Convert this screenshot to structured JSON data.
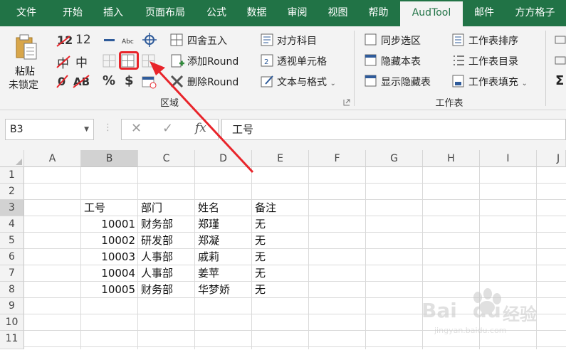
{
  "ribbon_tabs": [
    "文件",
    "开始",
    "插入",
    "页面布局",
    "公式",
    "数据",
    "审阅",
    "视图",
    "帮助",
    "AudTool",
    "邮件",
    "方方格子"
  ],
  "active_tab": "AudTool",
  "colors": {
    "brand": "#217346",
    "highlight": "#e8242a"
  },
  "ribbon": {
    "unlock_label_1": "粘贴",
    "unlock_label_2": "未锁定",
    "num12": "12",
    "zhong": "中",
    "percent": "%",
    "dollar": "$",
    "round_round": "四舍五入",
    "add_round": "添加Round",
    "del_round": "删除Round",
    "dui_fang": "对方科目",
    "pivot_cell": "透视单元格",
    "text_format": "文本与格式",
    "sync_select": "同步选区",
    "hide_sheet": "隐藏本表",
    "show_hidden": "显示隐藏表",
    "sheet_sort": "工作表排序",
    "sheet_toc": "工作表目录",
    "sheet_fill": "工作表填充",
    "group_quyu": "区域",
    "group_sheet": "工作表"
  },
  "name_box": "B3",
  "formula_value": "工号",
  "columns": [
    "A",
    "B",
    "C",
    "D",
    "E",
    "F",
    "G",
    "H",
    "I",
    "J"
  ],
  "rows": [
    "1",
    "2",
    "3",
    "4",
    "5",
    "6",
    "7",
    "8",
    "9",
    "10",
    "11"
  ],
  "table": {
    "headers": [
      "工号",
      "部门",
      "姓名",
      "备注"
    ],
    "rows": [
      [
        "10001",
        "财务部",
        "郑瑾",
        "无"
      ],
      [
        "10002",
        "研发部",
        "郑凝",
        "无"
      ],
      [
        "10003",
        "人事部",
        "戚莉",
        "无"
      ],
      [
        "10004",
        "人事部",
        "姜苹",
        "无"
      ],
      [
        "10005",
        "财务部",
        "华梦娇",
        "无"
      ]
    ]
  },
  "watermark": {
    "brand": "Bai",
    "brand2": "du",
    "cn": "经验",
    "url": "jingyan.baidu.com"
  }
}
